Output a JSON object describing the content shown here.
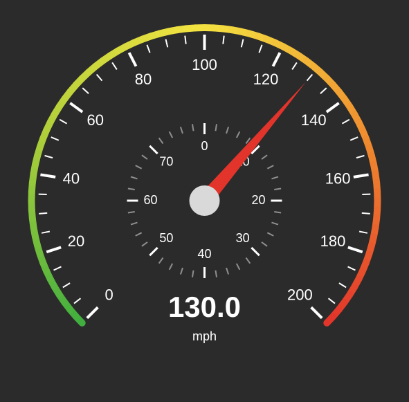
{
  "chart_data": {
    "type": "gauge",
    "title": "",
    "unit": "mph",
    "value": 130.0,
    "outer_axis": {
      "min": 0,
      "max": 200,
      "major_ticks": [
        0,
        20,
        40,
        60,
        80,
        100,
        120,
        140,
        160,
        180,
        200
      ],
      "minor_step": 5,
      "start_angle_deg": -225,
      "end_angle_deg": 45
    },
    "inner_axis": {
      "min": 0,
      "max": 80,
      "major_ticks": [
        0,
        10,
        20,
        30,
        40,
        50,
        60,
        70
      ],
      "minor_step": 2,
      "start_angle_deg": -90,
      "end_angle_deg": 270
    },
    "arc_gradient_stops": [
      {
        "t": 0.0,
        "color": "#3fae3f"
      },
      {
        "t": 0.25,
        "color": "#aecf3a"
      },
      {
        "t": 0.5,
        "color": "#f4e341"
      },
      {
        "t": 0.75,
        "color": "#f08f2f"
      },
      {
        "t": 1.0,
        "color": "#e2342b"
      }
    ],
    "colors": {
      "bg": "#2b2b2b",
      "tick": "#ffffff",
      "tick_minor": "#8f8f8f",
      "needle": "#e2342b",
      "hub": "#d9d9d9"
    }
  },
  "readout": {
    "value_text": "130.0",
    "unit_text": "mph"
  }
}
